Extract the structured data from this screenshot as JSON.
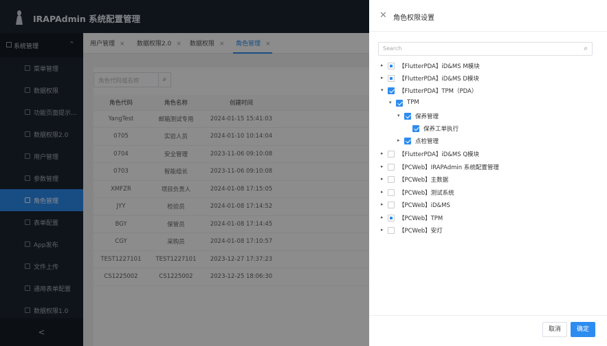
{
  "app": {
    "title": "IRAPAdmin 系统配置管理"
  },
  "sidebar": {
    "group": {
      "label": "系统管理",
      "chevron": "^"
    },
    "items": [
      {
        "label": "菜单管理"
      },
      {
        "label": "数据权限"
      },
      {
        "label": "功能页面提示..."
      },
      {
        "label": "数据权限2.0"
      },
      {
        "label": "用户管理"
      },
      {
        "label": "参数管理"
      },
      {
        "label": "角色管理"
      },
      {
        "label": "表单配置"
      },
      {
        "label": "App发布"
      },
      {
        "label": "文件上传"
      },
      {
        "label": "通用表单配置"
      },
      {
        "label": "数据权限1.0"
      }
    ],
    "collapse_label": "<"
  },
  "tabs": [
    {
      "label": "用户管理",
      "close": "×"
    },
    {
      "label": "数据权限2.0",
      "close": "×"
    },
    {
      "label": "数据权限",
      "close": "×"
    },
    {
      "label": "角色管理",
      "close": "×"
    }
  ],
  "search": {
    "placeholder": "角色代码或名称",
    "icon": "search-icon"
  },
  "table": {
    "headers": [
      "角色代码",
      "角色名称",
      "创建时间"
    ],
    "rows": [
      [
        "YangTest",
        "邮箱测试专用",
        "2024-01-15 15:41:03"
      ],
      [
        "0705",
        "实验人员",
        "2024-01-10 10:14:04"
      ],
      [
        "0704",
        "安全管理",
        "2023-11-06 09:10:08"
      ],
      [
        "0703",
        "智能组长",
        "2023-11-06 09:10:08"
      ],
      [
        "XMFZR",
        "项目负责人",
        "2024-01-08 17:15:05"
      ],
      [
        "JYY",
        "检验员",
        "2024-01-08 17:14:52"
      ],
      [
        "BGY",
        "保管员",
        "2024-01-08 17:14:45"
      ],
      [
        "CGY",
        "采购员",
        "2024-01-08 17:10:57"
      ],
      [
        "TEST1227101",
        "TEST1227101",
        "2023-12-27 17:37:23"
      ],
      [
        "CS1225002",
        "CS1225002",
        "2023-12-25 18:06:30"
      ]
    ]
  },
  "drawer": {
    "title": "角色权限设置",
    "search_placeholder": "Search",
    "tree": [
      {
        "label": "【FlutterPDA】iD&MS M模块",
        "state": "indeterminate"
      },
      {
        "label": "【FlutterPDA】iD&MS D模块",
        "state": "indeterminate"
      },
      {
        "label": "【FlutterPDA】TPM（PDA）",
        "state": "checked"
      },
      {
        "label": "TPM",
        "state": "checked"
      },
      {
        "label": "保养管理",
        "state": "checked"
      },
      {
        "label": "保养工单执行",
        "state": "checked"
      },
      {
        "label": "点检管理",
        "state": "checked"
      },
      {
        "label": "【FlutterPDA】iD&MS Q模块",
        "state": "unchecked"
      },
      {
        "label": "【PCWeb】IRAPAdmin 系统配置管理",
        "state": "unchecked"
      },
      {
        "label": "【PCWeb】主数据",
        "state": "unchecked"
      },
      {
        "label": "【PCWeb】测试系统",
        "state": "unchecked"
      },
      {
        "label": "【PCWeb】iD&MS",
        "state": "unchecked"
      },
      {
        "label": "【PCWeb】TPM",
        "state": "indeterminate"
      },
      {
        "label": "【PCWeb】安灯",
        "state": "unchecked"
      }
    ],
    "cancel_label": "取消",
    "ok_label": "确定"
  }
}
